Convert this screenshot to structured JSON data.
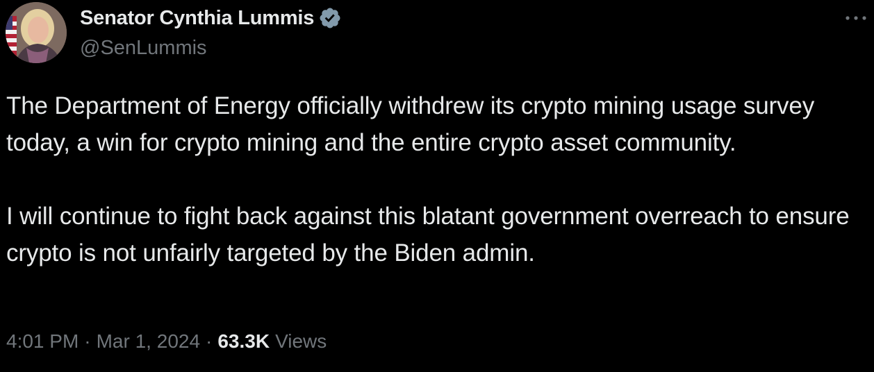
{
  "tweet": {
    "author": {
      "display_name": "Senator Cynthia Lummis",
      "handle": "@SenLummis",
      "verified_icon": "verified-badge-icon",
      "avatar": "profile-photo"
    },
    "text": "The Department of Energy officially withdrew its crypto mining usage survey today, a win for crypto mining and the entire crypto asset community.\n\nI will continue to fight back against this blatant government overreach to ensure crypto is not unfairly targeted by the Biden admin.",
    "meta": {
      "time": "4:01 PM",
      "separator": "·",
      "date": "Mar 1, 2024",
      "views_count": "63.3K",
      "views_label": "Views"
    },
    "more_icon": "more-options-icon"
  },
  "colors": {
    "background": "#000000",
    "primary_text": "#e7e9ea",
    "secondary_text": "#71767b",
    "verified_badge": "#829aab"
  }
}
